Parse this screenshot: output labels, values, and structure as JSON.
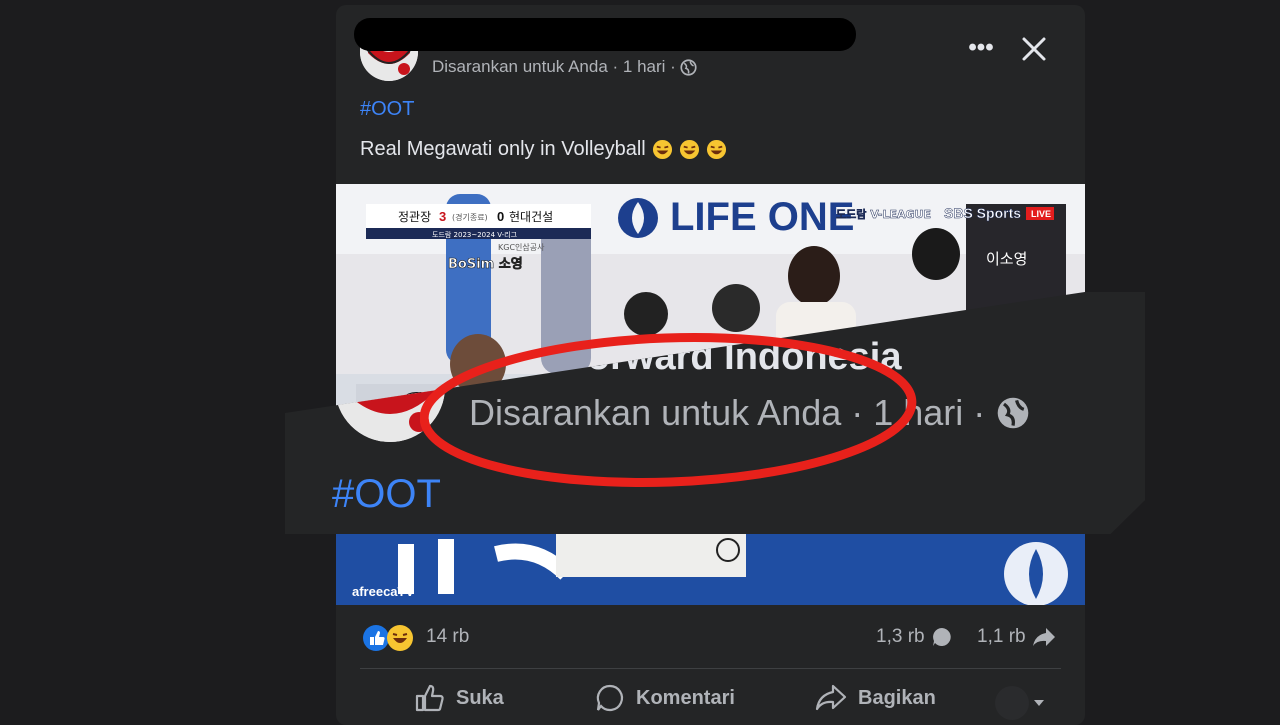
{
  "post": {
    "meta": "Disarankan untuk Anda · 1 hari ·",
    "hashtag": "#OOT",
    "text": "Real Megawati only in Volleyball",
    "emojis": [
      "rolling-on-floor-laughing",
      "rolling-on-floor-laughing",
      "rolling-on-floor-laughing"
    ]
  },
  "media": {
    "score_home": "정관장",
    "score_home_value": "3",
    "score_mid": "(경기종료)",
    "score_away_value": "0",
    "score_away": "현대건설",
    "score_sub": "도드람 2023~2024 V-리그",
    "sponsor": "LIFE ONE",
    "league": "도드람 V-LEAGUE",
    "broadcaster": "SBS Sports",
    "live": "LIVE",
    "watermark": "afreecaTV",
    "jersey_text": "이소영",
    "team_tag": "KGC인삼공사",
    "caption_small": "BoSim 소영"
  },
  "zoom": {
    "title": "tball Forward Indonesia",
    "meta": "Disarankan untuk Anda · 1 hari ·",
    "hashtag": "#OOT"
  },
  "stats": {
    "reactions": "14 rb",
    "comments": "1,3 rb",
    "shares": "1,1 rb"
  },
  "actions": {
    "like": "Suka",
    "comment": "Komentari",
    "share": "Bagikan"
  },
  "colors": {
    "background": "#1c1c1e",
    "card": "#242526",
    "link": "#3d84f7",
    "highlight": "#e8211b"
  }
}
